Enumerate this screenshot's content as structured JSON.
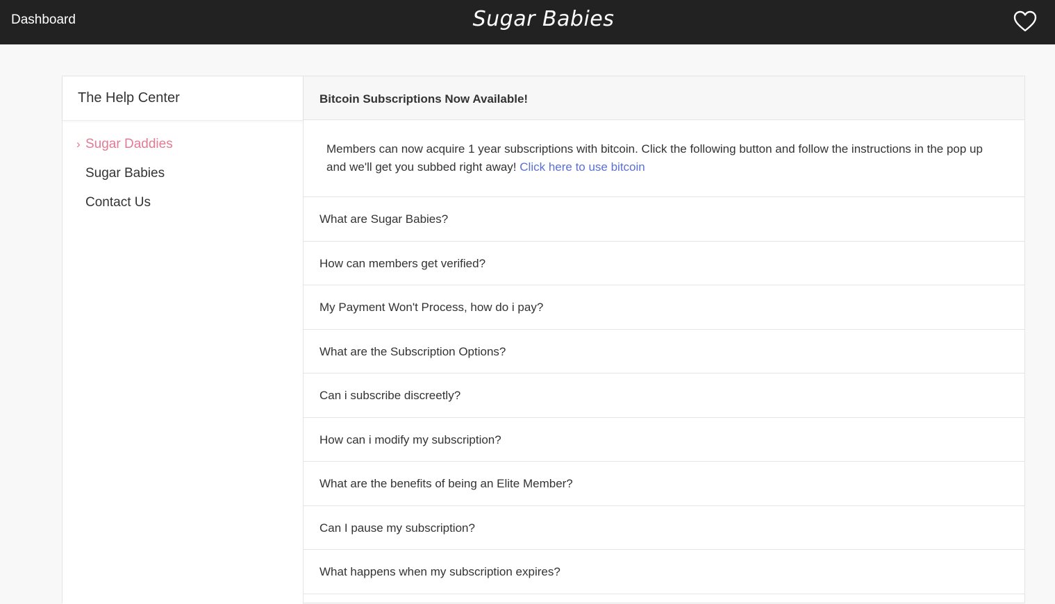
{
  "topbar": {
    "dashboard_label": "Dashboard",
    "logo_text": "Sugar Babies",
    "favorites_icon": "heart-icon"
  },
  "sidebar": {
    "title": "The Help Center",
    "items": [
      {
        "label": "Sugar Daddies",
        "active": true
      },
      {
        "label": "Sugar Babies",
        "active": false
      },
      {
        "label": "Contact Us",
        "active": false
      }
    ]
  },
  "notice": {
    "title": "Bitcoin Subscriptions Now Available!",
    "body": "Members can now acquire 1 year subscriptions with bitcoin. Click the following button and follow the instructions in the pop up and we'll get you subbed right away!",
    "link_text": "Click here to use bitcoin"
  },
  "faq": [
    {
      "question": "What are Sugar Babies?"
    },
    {
      "question": "How can members get verified?"
    },
    {
      "question": "My Payment Won't Process, how do i pay?"
    },
    {
      "question": "What are the Subscription Options?"
    },
    {
      "question": "Can i subscribe discreetly?"
    },
    {
      "question": "How can i modify my subscription?"
    },
    {
      "question": "What are the benefits of being an Elite Member?"
    },
    {
      "question": "Can I pause my subscription?"
    },
    {
      "question": "What happens when my subscription expires?"
    }
  ],
  "colors": {
    "topbar_bg": "#222222",
    "accent_pink": "#e57a92",
    "link_blue": "#5a6fd4"
  }
}
